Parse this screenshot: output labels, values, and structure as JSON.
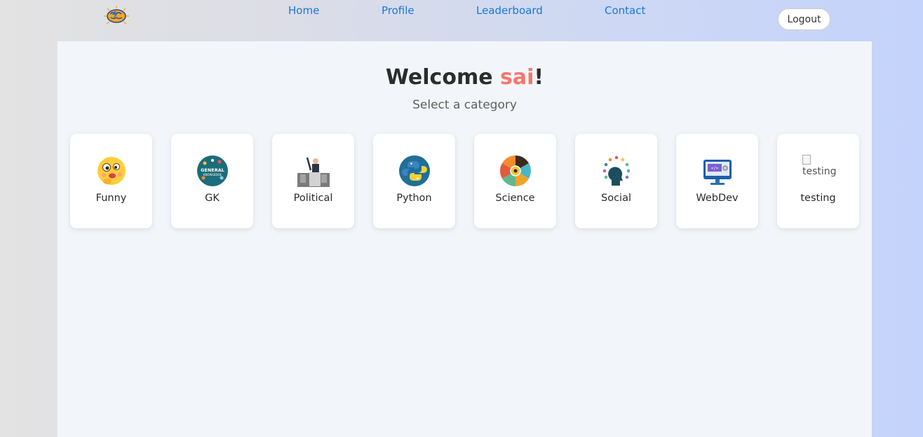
{
  "nav": {
    "logo_icon": "brain-logo-icon",
    "links": [
      "Home",
      "Profile",
      "Leaderboard",
      "Contact"
    ],
    "logout_label": "Logout"
  },
  "welcome": {
    "prefix": "Welcome ",
    "username": "sai",
    "suffix": "!",
    "subtitle": "Select a category"
  },
  "categories": [
    {
      "label": "Funny",
      "icon": "emoji-face-icon"
    },
    {
      "label": "GK",
      "icon": "general-knowledge-icon",
      "icon_text": [
        "GENERAL",
        "KNOWLEDGE"
      ]
    },
    {
      "label": "Political",
      "icon": "politician-podium-icon"
    },
    {
      "label": "Python",
      "icon": "python-logo-icon"
    },
    {
      "label": "Science",
      "icon": "science-wheel-icon"
    },
    {
      "label": "Social",
      "icon": "social-head-icon"
    },
    {
      "label": "WebDev",
      "icon": "web-monitor-icon"
    },
    {
      "label": "testing",
      "icon": "broken-image-icon",
      "alt": "testing"
    }
  ],
  "colors": {
    "accent_link": "#1877d8",
    "username": "#f7766b",
    "container_bg": "#f2f6fa"
  }
}
